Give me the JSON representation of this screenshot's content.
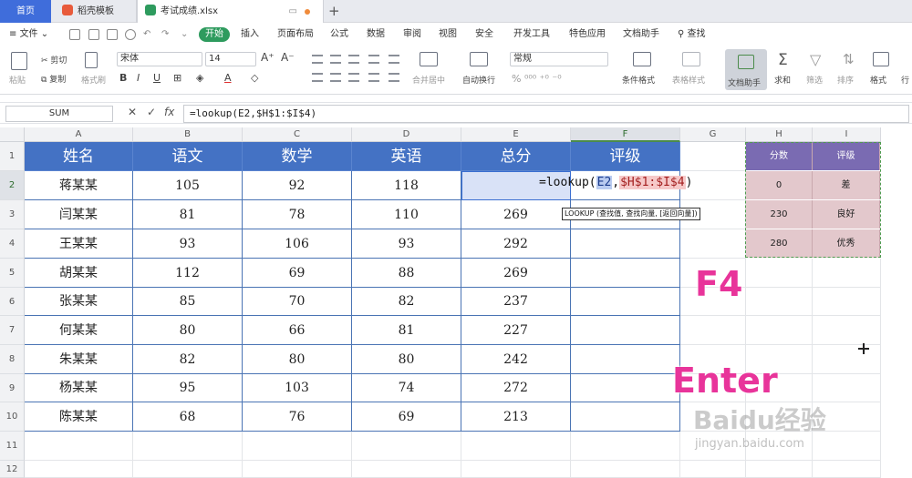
{
  "tabs": {
    "home": "首页",
    "template": "稻壳模板",
    "file": "考试成绩.xlsx",
    "add": "+"
  },
  "menu": {
    "file": "文件",
    "items": [
      "开始",
      "插入",
      "页面布局",
      "公式",
      "数据",
      "审阅",
      "视图",
      "安全",
      "开发工具",
      "特色应用",
      "文档助手",
      "查找"
    ]
  },
  "ribbon": {
    "paste": "粘贴",
    "cut": "剪切",
    "copy": "复制",
    "format_painter": "格式刷",
    "font_name": "宋体",
    "font_size": "14",
    "merge_center": "合并居中",
    "wrap_text": "自动换行",
    "number_format": "常规",
    "conditional_format": "条件格式",
    "table_style": "表格样式",
    "doc_assistant": "文档助手",
    "sum": "求和",
    "filter": "筛选",
    "sort": "排序",
    "format": "格式",
    "row_col": "行"
  },
  "formula_bar": {
    "name_box": "SUM",
    "cancel": "✕",
    "confirm": "✓",
    "fx": "fx",
    "formula": "=lookup(E2,$H$1:$I$4)"
  },
  "columns": [
    "A",
    "B",
    "C",
    "D",
    "E",
    "F",
    "G",
    "H",
    "I"
  ],
  "rows": [
    "1",
    "2",
    "3",
    "4",
    "5",
    "6",
    "7",
    "8",
    "9",
    "10",
    "11",
    "12"
  ],
  "table": {
    "headers": [
      "姓名",
      "语文",
      "数学",
      "英语",
      "总分",
      "评级"
    ],
    "rows": [
      [
        "蒋某某",
        "105",
        "92",
        "118",
        "",
        ""
      ],
      [
        "闫某某",
        "81",
        "78",
        "110",
        "269",
        ""
      ],
      [
        "王某某",
        "93",
        "106",
        "93",
        "292",
        ""
      ],
      [
        "胡某某",
        "112",
        "69",
        "88",
        "269",
        ""
      ],
      [
        "张某某",
        "85",
        "70",
        "82",
        "237",
        ""
      ],
      [
        "何某某",
        "80",
        "66",
        "81",
        "227",
        ""
      ],
      [
        "朱某某",
        "82",
        "80",
        "80",
        "242",
        ""
      ],
      [
        "杨某某",
        "95",
        "103",
        "74",
        "272",
        ""
      ],
      [
        "陈某某",
        "68",
        "76",
        "69",
        "213",
        ""
      ]
    ]
  },
  "lookup_table": {
    "headers": [
      "分数",
      "评级"
    ],
    "rows": [
      [
        "0",
        "差"
      ],
      [
        "230",
        "良好"
      ],
      [
        "280",
        "优秀"
      ]
    ]
  },
  "editor": {
    "prefix": "=lookup(",
    "arg1": "E2",
    "sep": ",",
    "arg2": "$H$1:$I$4",
    "suffix": ")"
  },
  "tooltip": "LOOKUP (查找值, 查找向量, [返回向量])",
  "annotations": {
    "f4": "F4",
    "enter": "Enter"
  },
  "watermark": {
    "text": "Baidu经验",
    "url": "jingyan.baidu.com"
  },
  "colors": {
    "header_blue": "#4472c4",
    "lookup_header": "#7a6bb2",
    "lookup_body": "#e3c8cc",
    "annotation": "#e8349a",
    "start_green": "#2e9b5e"
  }
}
